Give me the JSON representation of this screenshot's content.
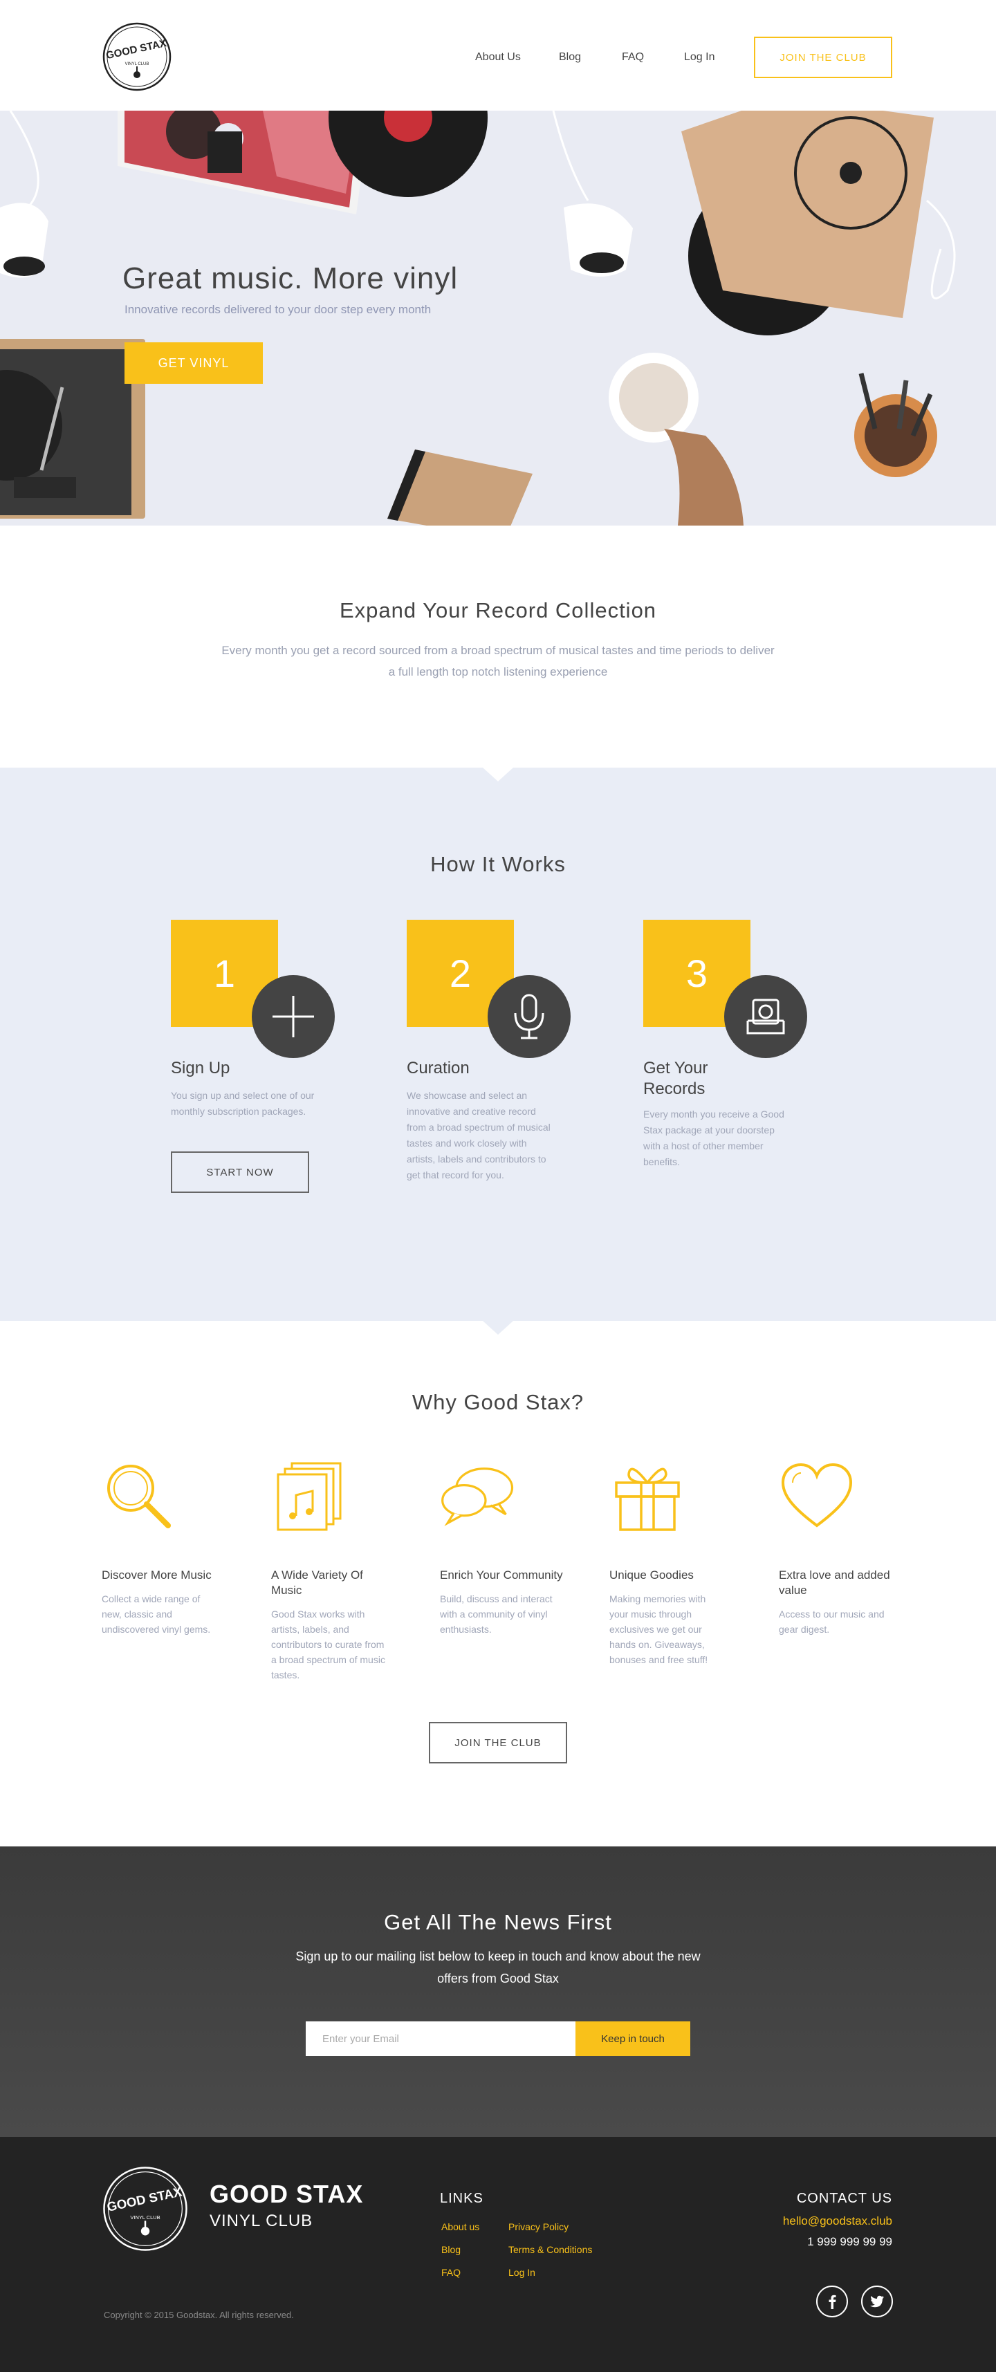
{
  "colors": {
    "accent": "#f9c11a",
    "hero_bg": "#e9ebf3",
    "how_bg": "#e9edf6",
    "dark": "#444444",
    "footer_bg": "#232323"
  },
  "logo": {
    "line1": "GOOD STAX",
    "line2": "VINYL CLUB"
  },
  "nav": {
    "about": "About Us",
    "blog": "Blog",
    "faq": "FAQ",
    "login": "Log In",
    "join": "JOIN THE CLUB"
  },
  "hero": {
    "title": "Great music. More vinyl",
    "subtitle": "Innovative records delivered to your door step every month",
    "button": "GET VINYL"
  },
  "expand": {
    "title": "Expand Your Record Collection",
    "text": "Every month you get a record sourced from a broad spectrum of musical tastes and time periods to deliver a full length top notch listening experience"
  },
  "how": {
    "title": "How It Works",
    "steps": [
      {
        "number": "1",
        "title": "Sign Up",
        "text": "You sign up and select one of our monthly subscription packages.",
        "icon": "plus-icon"
      },
      {
        "number": "2",
        "title": "Curation",
        "text": "We showcase and select an innovative and creative record from a broad spectrum of musical tastes and work closely with artists, labels and contributors to get that record for you.",
        "icon": "microphone-icon"
      },
      {
        "number": "3",
        "title": "Get Your Records",
        "text": "Every month you receive a Good Stax package at your doorstep with a host of other member benefits.",
        "icon": "package-icon"
      }
    ],
    "start_button": "START NOW"
  },
  "why": {
    "title": "Why Good Stax?",
    "features": [
      {
        "title": "Discover More Music",
        "text": "Collect a wide range of new, classic and undiscovered vinyl gems.",
        "icon": "magnifier-icon"
      },
      {
        "title": "A Wide Variety Of Music",
        "text": "Good Stax works with artists, labels, and contributors to curate from a broad spectrum of music tastes.",
        "icon": "music-stack-icon"
      },
      {
        "title": "Enrich Your Community",
        "text": "Build, discuss and interact with a community of vinyl enthusiasts.",
        "icon": "chat-bubbles-icon"
      },
      {
        "title": "Unique Goodies",
        "text": "Making memories with your music through exclusives we get our hands on. Giveaways, bonuses and free stuff!",
        "icon": "gift-icon"
      },
      {
        "title": "Extra love and added value",
        "text": "Access to our music and gear digest.",
        "icon": "heart-icon"
      }
    ],
    "join_button": "JOIN THE CLUB"
  },
  "news": {
    "title": "Get All The News First",
    "text": "Sign up to our mailing list below to keep in touch and know about the new offers from Good Stax",
    "placeholder": "Enter your Email",
    "button": "Keep in touch"
  },
  "footer": {
    "brand": "GOOD STAX",
    "brand_sub": "VINYL CLUB",
    "links_title": "LINKS",
    "links": [
      "About us",
      "Blog",
      "FAQ",
      "Privacy Policy",
      "Terms & Conditions",
      "Log In"
    ],
    "contact_title": "CONTACT US",
    "email": "hello@goodstax.club",
    "phone": "1 999 999 99 99",
    "copyright": "Copyright © 2015 Goodstax. All rights reserved.",
    "social": [
      "facebook-icon",
      "twitter-icon"
    ]
  }
}
